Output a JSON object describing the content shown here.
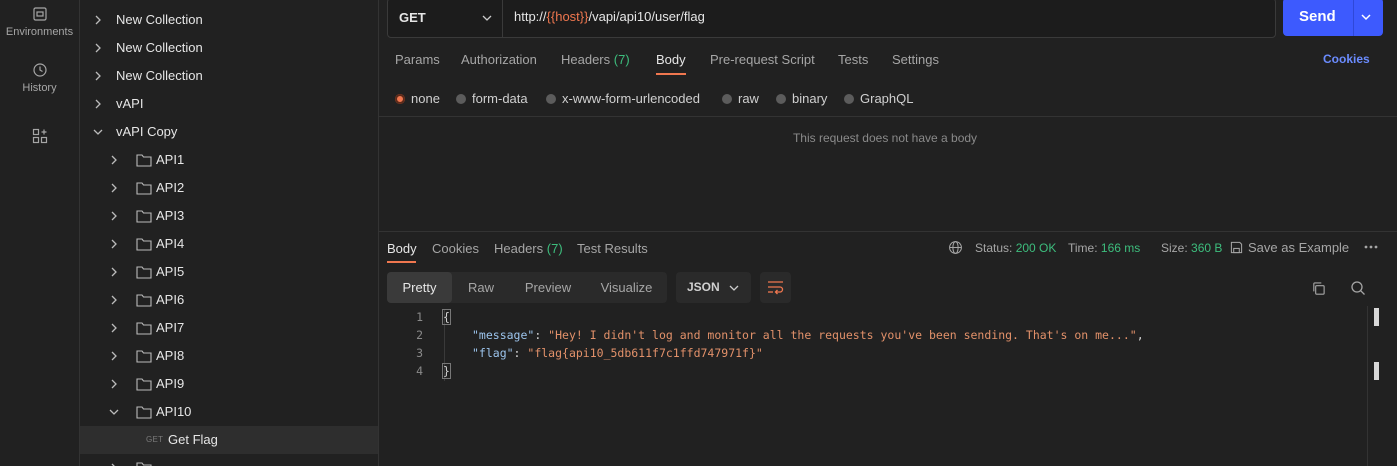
{
  "rail": {
    "items": [
      {
        "label": "Environments",
        "icon": "environments-icon"
      },
      {
        "label": "History",
        "icon": "history-icon"
      },
      {
        "label": "",
        "icon": "configure-workspace-icon"
      }
    ]
  },
  "tree": {
    "collections": [
      "New Collection",
      "New Collection",
      "New Collection",
      "vAPI",
      "vAPI Copy"
    ],
    "folders": [
      "API1",
      "API2",
      "API3",
      "API4",
      "API5",
      "API6",
      "API7",
      "API8",
      "API9",
      "API10"
    ],
    "request": {
      "method": "GET",
      "name": "Get Flag"
    }
  },
  "request": {
    "method": "GET",
    "url_prefix": "http://",
    "url_var": "{{host}}",
    "url_suffix": "/vapi/api10/user/flag",
    "send_label": "Send",
    "tabs": [
      "Params",
      "Authorization",
      "Headers",
      "Body",
      "Pre-request Script",
      "Tests",
      "Settings"
    ],
    "headers_count": "(7)",
    "active_tab": "Body",
    "cookies_link": "Cookies",
    "body_types": [
      "none",
      "form-data",
      "x-www-form-urlencoded",
      "raw",
      "binary",
      "GraphQL"
    ],
    "selected_body_type": "none",
    "empty_body_msg": "This request does not have a body"
  },
  "response": {
    "tabs": [
      "Body",
      "Cookies",
      "Headers",
      "Test Results"
    ],
    "headers_count": "(7)",
    "status_label": "Status:",
    "status_value": "200 OK",
    "time_label": "Time:",
    "time_value": "166 ms",
    "size_label": "Size:",
    "size_value": "360 B",
    "save_example": "Save as Example",
    "views": [
      "Pretty",
      "Raw",
      "Preview",
      "Visualize"
    ],
    "active_view": "Pretty",
    "format": "JSON",
    "lines": [
      "1",
      "2",
      "3",
      "4"
    ],
    "json": {
      "open": "{",
      "k1": "\"message\"",
      "v1": "\"Hey! I didn't log and monitor all the requests you've been sending. That's on me...\"",
      "k2": "\"flag\"",
      "v2": "\"flag{api10_5db611f7c1ffd747971f}\"",
      "close": "}"
    }
  },
  "colors": {
    "accent": "#f0774f",
    "send": "#3d5afe",
    "status_green": "#3dbd7d",
    "link_blue": "#6b8cff"
  }
}
